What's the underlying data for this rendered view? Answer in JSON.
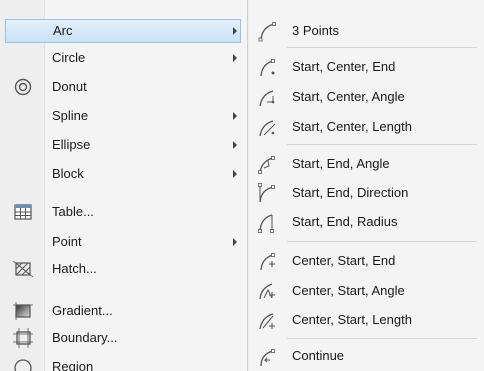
{
  "draw_menu": {
    "items": [
      {
        "label": "Arc",
        "icon": "none",
        "submenu": true,
        "highlighted": true
      },
      {
        "label": "Circle",
        "icon": "none",
        "submenu": true
      },
      {
        "label": "Donut",
        "icon": "donut-icon",
        "submenu": false
      },
      {
        "label": "Spline",
        "icon": "none",
        "submenu": true
      },
      {
        "label": "Ellipse",
        "icon": "none",
        "submenu": true
      },
      {
        "label": "Block",
        "icon": "none",
        "submenu": true
      },
      {
        "label": "Table...",
        "icon": "table-icon",
        "submenu": false
      },
      {
        "label": "Point",
        "icon": "none",
        "submenu": true
      },
      {
        "label": "Hatch...",
        "icon": "hatch-icon",
        "submenu": false
      },
      {
        "label": "Gradient...",
        "icon": "gradient-icon",
        "submenu": false
      },
      {
        "label": "Boundary...",
        "icon": "boundary-icon",
        "submenu": false
      },
      {
        "label": "Region",
        "icon": "region-icon",
        "submenu": false
      }
    ]
  },
  "arc_submenu": {
    "items": [
      {
        "label": "3 Points",
        "icon": "arc-3-points-icon"
      },
      {
        "label": "Start, Center, End",
        "icon": "arc-start-center-end-icon"
      },
      {
        "label": "Start, Center, Angle",
        "icon": "arc-start-center-angle-icon"
      },
      {
        "label": "Start, Center, Length",
        "icon": "arc-start-center-length-icon"
      },
      {
        "label": "Start, End, Angle",
        "icon": "arc-start-end-angle-icon"
      },
      {
        "label": "Start, End, Direction",
        "icon": "arc-start-end-direction-icon"
      },
      {
        "label": "Start, End, Radius",
        "icon": "arc-start-end-radius-icon"
      },
      {
        "label": "Center, Start, End",
        "icon": "arc-center-start-end-icon"
      },
      {
        "label": "Center, Start, Angle",
        "icon": "arc-center-start-angle-icon"
      },
      {
        "label": "Center, Start, Length",
        "icon": "arc-center-start-length-icon"
      },
      {
        "label": "Continue",
        "icon": "arc-continue-icon"
      }
    ]
  },
  "colors": {
    "highlight_fill": "#c9e2f6",
    "highlight_border": "#99c3e8",
    "menu_background": "#f4f4f4",
    "icon_stroke": "#555555",
    "icon_accent": "#3a6fb0"
  }
}
